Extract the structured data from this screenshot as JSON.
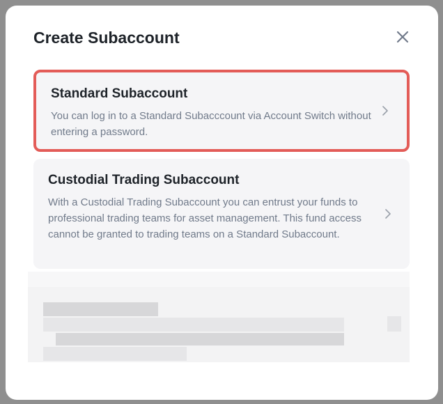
{
  "modal": {
    "title": "Create Subaccount",
    "close_icon": "close-icon"
  },
  "options": [
    {
      "title": "Standard Subaccount",
      "description": "You can log in to a Standard Subacccount via Account Switch without entering a password.",
      "icon": "chevron-right-icon",
      "highlighted": true
    },
    {
      "title": "Custodial Trading Subaccount",
      "description": "With a Custodial Trading Subaccount you can entrust your funds to professional trading teams for asset management. This fund access cannot be granted to trading teams on a Standard Subaccount.",
      "icon": "chevron-right-icon",
      "highlighted": false
    }
  ],
  "colors": {
    "highlight_border": "#e35c58",
    "card_background": "#f5f5f7",
    "title_text": "#1e2329",
    "description_text": "#707a8a"
  }
}
